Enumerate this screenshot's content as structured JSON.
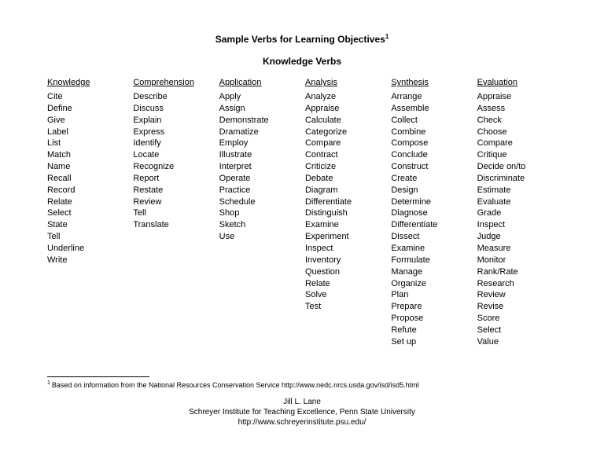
{
  "title": "Sample Verbs for Learning Objectives",
  "title_footnote_marker": "1",
  "subtitle": "Knowledge Verbs",
  "columns": [
    {
      "header": "Knowledge",
      "words": [
        "Cite",
        "Define",
        "Give",
        "Label",
        "List",
        "Match",
        "Name",
        "Recall",
        "Record",
        "Relate",
        "Select",
        "State",
        "Tell",
        "Underline",
        "Write"
      ]
    },
    {
      "header": "Comprehension",
      "words": [
        "Describe",
        "Discuss",
        "Explain",
        "Express",
        "Identify",
        "Locate",
        "Recognize",
        "Report",
        "Restate",
        "Review",
        "Tell",
        "Translate"
      ]
    },
    {
      "header": "Application",
      "words": [
        "Apply",
        "Assign",
        "Demonstrate",
        "Dramatize",
        "Employ",
        "Illustrate",
        "Interpret",
        "Operate",
        "Practice",
        "Schedule",
        "Shop",
        "Sketch",
        "Use"
      ]
    },
    {
      "header": "Analysis",
      "words": [
        "Analyze",
        "Appraise",
        "Calculate",
        "Categorize",
        "Compare",
        "Contract",
        "Criticize",
        "Debate",
        "Diagram",
        "Differentiate",
        "Distinguish",
        "Examine",
        "Experiment",
        "Inspect",
        "Inventory",
        "Question",
        "Relate",
        "Solve",
        "Test"
      ]
    },
    {
      "header": "Synthesis",
      "words": [
        "Arrange",
        "Assemble",
        "Collect",
        "Combine",
        "Compose",
        "Conclude",
        "Construct",
        "Create",
        "Design",
        "Determine",
        "Diagnose",
        "Differentiate",
        "Dissect",
        "Examine",
        "Formulate",
        "Manage",
        "Organize",
        "Plan",
        "Prepare",
        "Propose",
        "Refute",
        "Set up"
      ]
    },
    {
      "header": "Evaluation",
      "words": [
        "Appraise",
        "Assess",
        "Check",
        "Choose",
        "Compare",
        "Critique",
        "Decide on/to",
        "Discriminate",
        "Estimate",
        "Evaluate",
        "Grade",
        "Inspect",
        "Judge",
        "Measure",
        "Monitor",
        "Rank/Rate",
        "Research",
        "Review",
        "Revise",
        "Score",
        "Select",
        "Value"
      ]
    }
  ],
  "footnote_marker": "1",
  "footnote_text": "Based on information from the National Resources Conservation Service http://www.nedc.nrcs.usda.gov/isd/isd5.html",
  "footer": {
    "author": "Jill L. Lane",
    "institute": "Schreyer Institute for Teaching Excellence, Penn State University",
    "url": "http://www.schreyerinstitute.psu.edu/"
  }
}
